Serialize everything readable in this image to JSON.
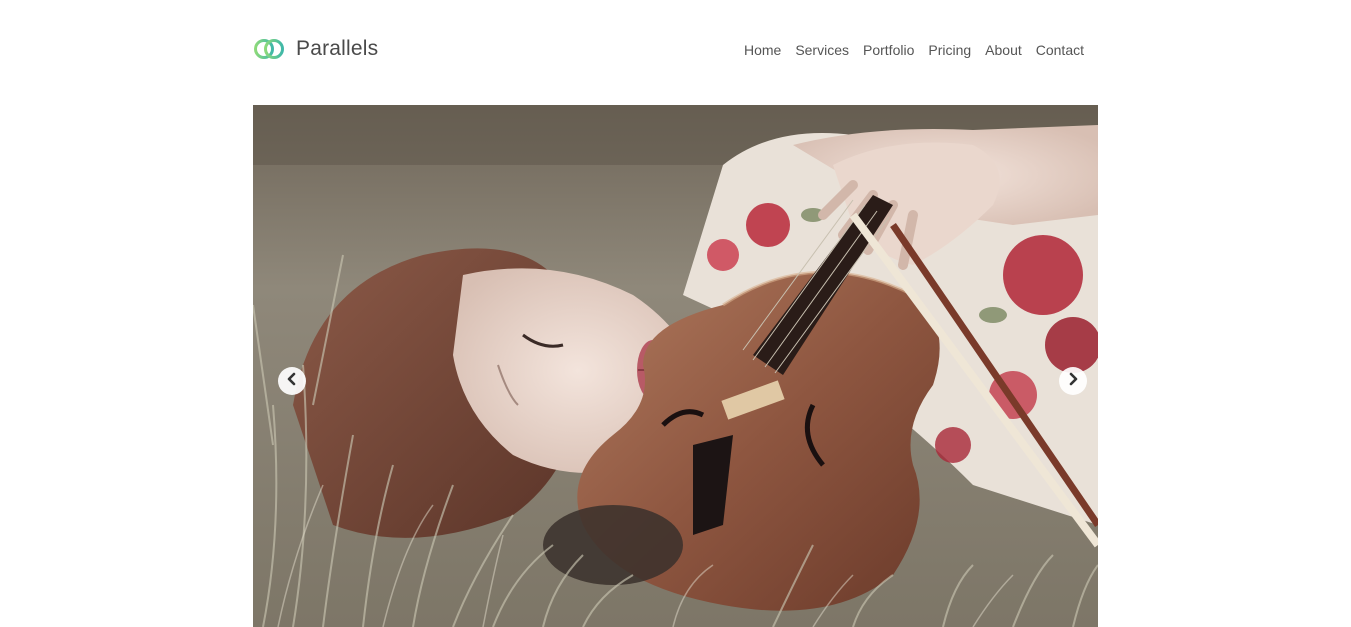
{
  "brand": {
    "name": "Parallels",
    "logo_icon": "interlocking-rings-icon",
    "logo_colors": [
      "#7fd08a",
      "#3fb8a8"
    ]
  },
  "nav": {
    "items": [
      {
        "label": "Home"
      },
      {
        "label": "Services"
      },
      {
        "label": "Portfolio"
      },
      {
        "label": "Pricing"
      },
      {
        "label": "About"
      },
      {
        "label": "Contact"
      }
    ]
  },
  "carousel": {
    "slide_image": "woman-with-violin-lying-in-grass",
    "prev_icon": "chevron-left-icon",
    "next_icon": "chevron-right-icon"
  },
  "colors": {
    "text": "#4a4a4a",
    "nav_text": "#555555",
    "background": "#ffffff"
  }
}
